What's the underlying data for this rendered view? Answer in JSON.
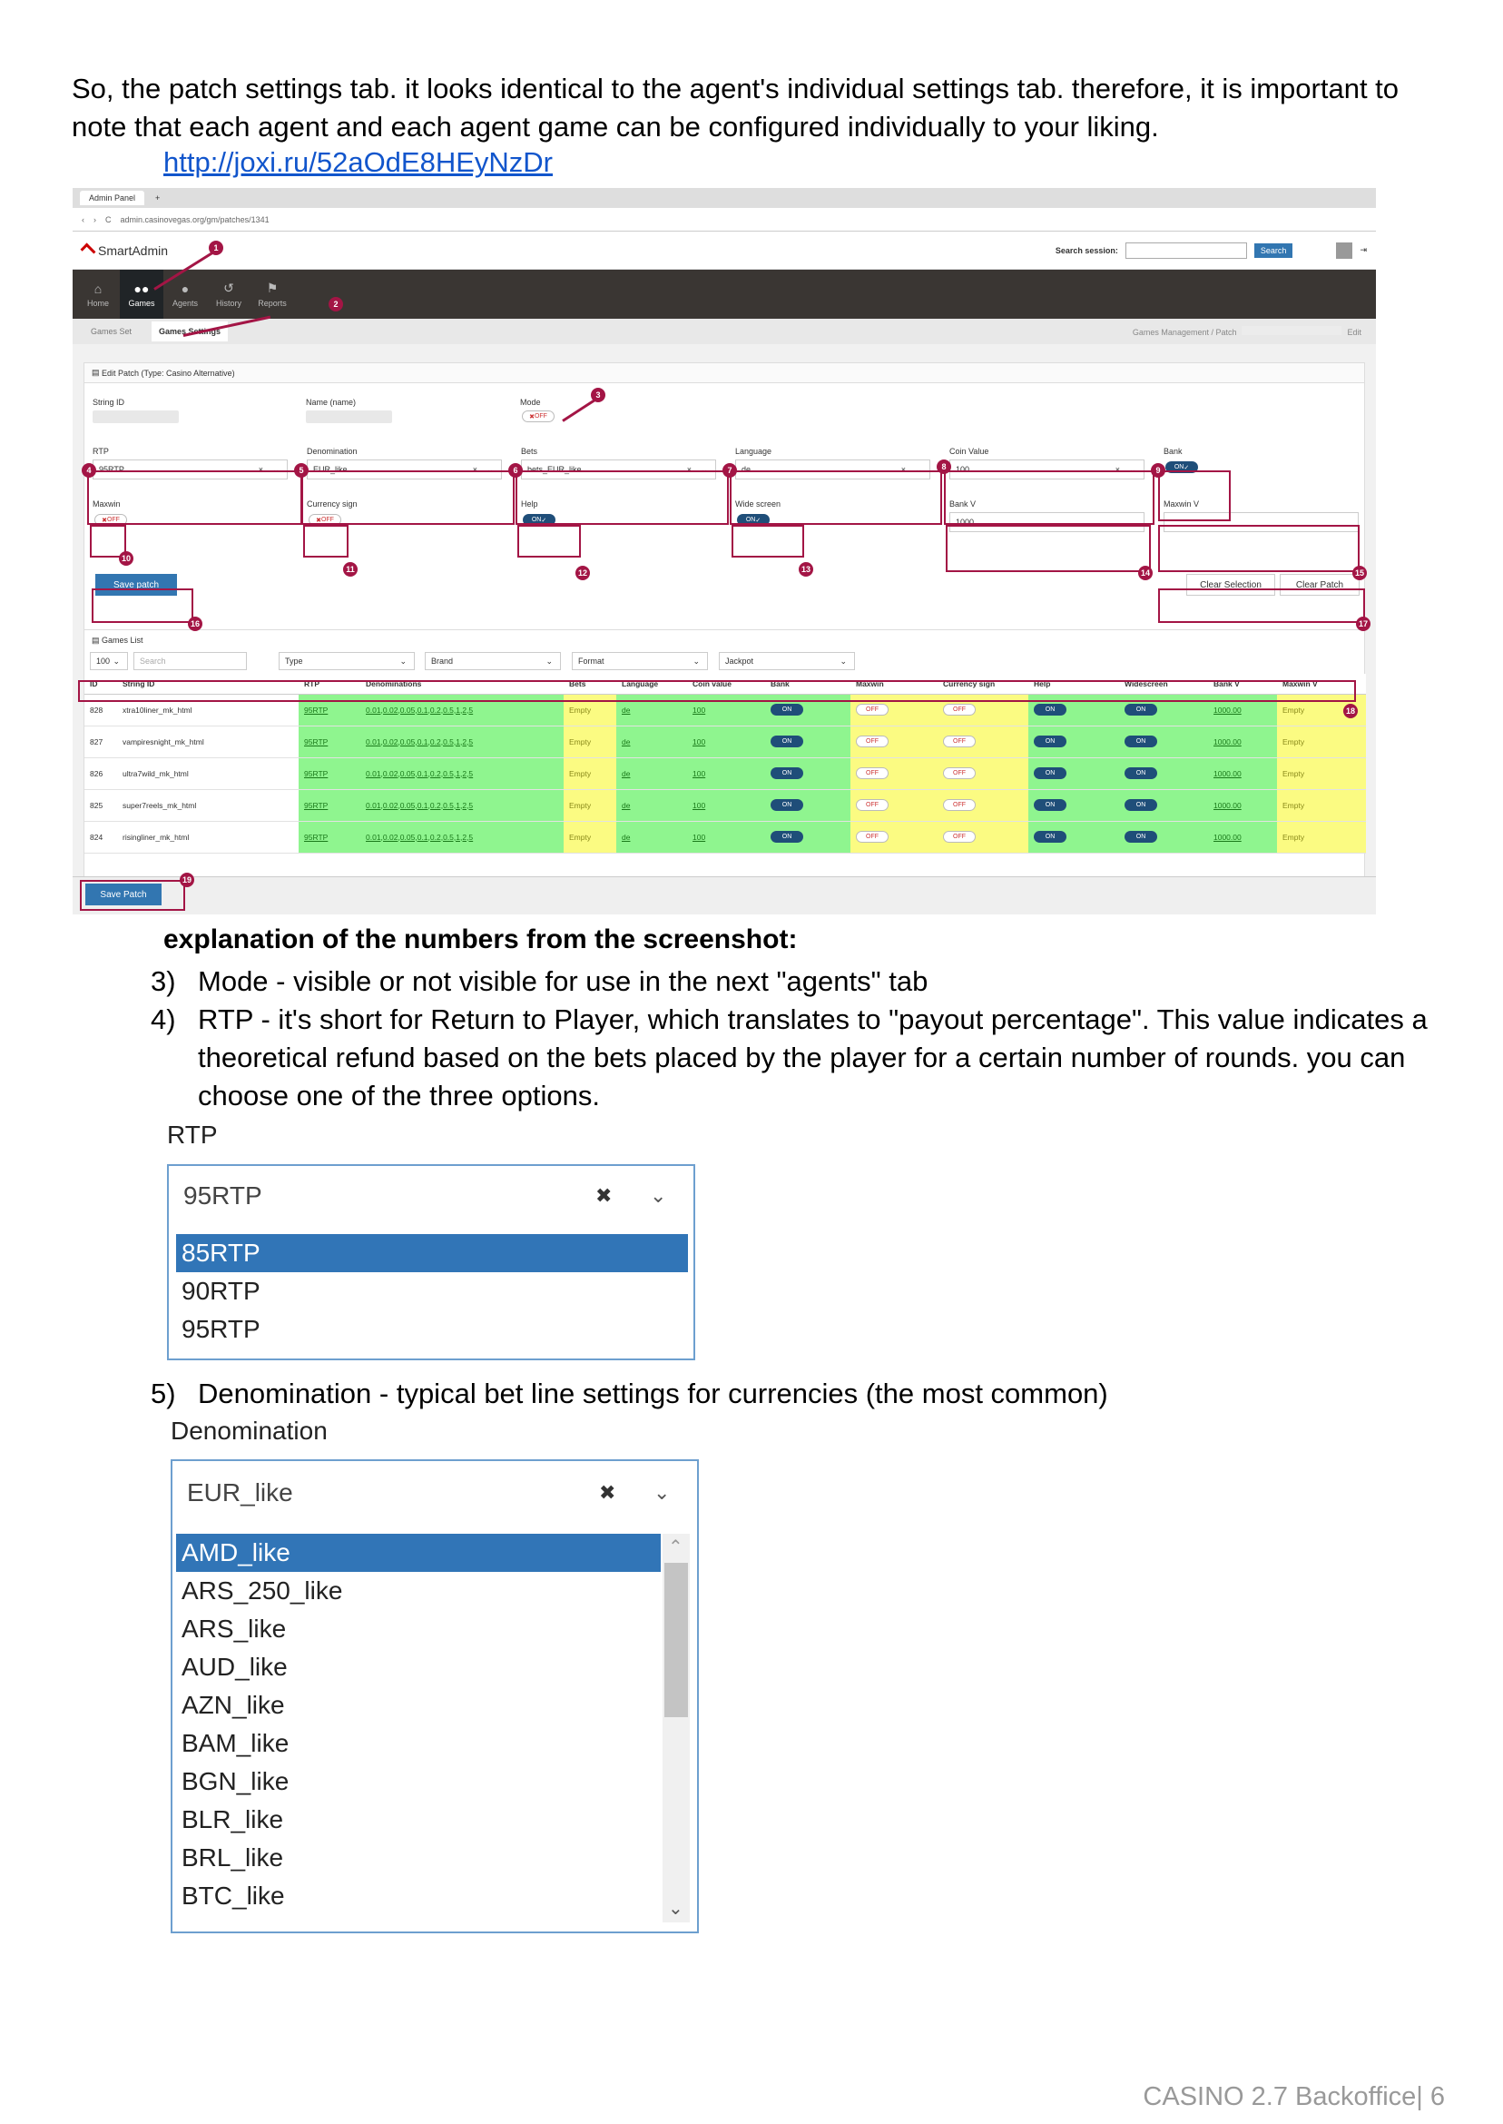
{
  "intro": "So, the patch settings tab. it looks identical to the agent's individual settings tab. therefore, it is important to note that each agent and each agent game can be configured individually to your liking.",
  "link": "http://joxi.ru/52aOdE8HEyNzDr",
  "screenshot": {
    "browser_tab": "Admin Panel",
    "url": "admin.casinovegas.org/gm/patches/1341",
    "logo": "SmartAdmin",
    "search_label": "Search session:",
    "search_button": "Search",
    "nav": [
      "Home",
      "Games",
      "Agents",
      "History",
      "Reports"
    ],
    "subnav": [
      "Games Set",
      "Games Settings"
    ],
    "breadcrumb": "Games Management  /  Patch",
    "breadcrumb_edit": "Edit",
    "edit_title": "Edit Patch (Type: Casino Alternative)",
    "string_id_label": "String ID",
    "name_label": "Name (name)",
    "mode_label": "Mode",
    "fields": {
      "rtp": {
        "label": "RTP",
        "value": "95RTP"
      },
      "denomination": {
        "label": "Denomination",
        "value": "EUR_like"
      },
      "bets": {
        "label": "Bets",
        "value": "bets_EUR_like"
      },
      "language": {
        "label": "Language",
        "value": "de"
      },
      "coin_value": {
        "label": "Coin Value",
        "value": "100"
      },
      "bank": {
        "label": "Bank"
      },
      "maxwin": {
        "label": "Maxwin"
      },
      "currency_sign": {
        "label": "Currency sign"
      },
      "help": {
        "label": "Help"
      },
      "wide_screen": {
        "label": "Wide screen"
      },
      "bank_v": {
        "label": "Bank V",
        "value": "1000"
      },
      "maxwin_v": {
        "label": "Maxwin V"
      }
    },
    "toggle_on": "ON",
    "toggle_off": "OFF",
    "save_patch": "Save patch",
    "clear_selection": "Clear Selection",
    "clear_patch": "Clear Patch",
    "games_list_title": "Games List",
    "filters": {
      "per_page": "100",
      "search": "Search",
      "type": "Type",
      "brand": "Brand",
      "format": "Format",
      "jackpot": "Jackpot"
    },
    "columns": [
      "ID",
      "String ID",
      "RTP",
      "Denominations",
      "Bets",
      "Language",
      "Coin value",
      "Bank",
      "Maxwin",
      "Currency sign",
      "Help",
      "Widescreen",
      "Bank V",
      "Maxwin V"
    ],
    "rows": [
      {
        "id": "828",
        "sid": "xtra10liner_mk_html",
        "rtp": "95RTP",
        "den": "0.01,0.02,0.05,0.1,0.2,0.5,1,2,5",
        "bets": "Empty",
        "lang": "de",
        "coin": "100",
        "bankv": "1000.00",
        "maxv": "Empty"
      },
      {
        "id": "827",
        "sid": "vampiresnight_mk_html",
        "rtp": "95RTP",
        "den": "0.01,0.02,0.05,0.1,0.2,0.5,1,2,5",
        "bets": "Empty",
        "lang": "de",
        "coin": "100",
        "bankv": "1000.00",
        "maxv": "Empty"
      },
      {
        "id": "826",
        "sid": "ultra7wild_mk_html",
        "rtp": "95RTP",
        "den": "0.01,0.02,0.05,0.1,0.2,0.5,1,2,5",
        "bets": "Empty",
        "lang": "de",
        "coin": "100",
        "bankv": "1000.00",
        "maxv": "Empty"
      },
      {
        "id": "825",
        "sid": "super7reels_mk_html",
        "rtp": "95RTP",
        "den": "0.01,0.02,0.05,0.1,0.2,0.5,1,2,5",
        "bets": "Empty",
        "lang": "de",
        "coin": "100",
        "bankv": "1000.00",
        "maxv": "Empty"
      },
      {
        "id": "824",
        "sid": "risingliner_mk_html",
        "rtp": "95RTP",
        "den": "0.01,0.02,0.05,0.1,0.2,0.5,1,2,5",
        "bets": "Empty",
        "lang": "de",
        "coin": "100",
        "bankv": "1000.00",
        "maxv": "Empty"
      }
    ],
    "save_patch_bottom": "Save Patch",
    "badges": [
      "1",
      "2",
      "3",
      "4",
      "5",
      "6",
      "7",
      "8",
      "9",
      "10",
      "11",
      "12",
      "13",
      "14",
      "15",
      "16",
      "17",
      "18",
      "19"
    ]
  },
  "explanation_heading": "explanation of the numbers from the screenshot:",
  "items": [
    {
      "num": "3)",
      "text": "Mode - visible or not visible for use in the next \"agents\" tab"
    },
    {
      "num": "4)",
      "text": "RTP -  it's short for Return to Player, which translates to \"payout percentage\". This value indicates a theoretical refund based on the bets placed by the player for a certain number of rounds. you can choose one of the three options."
    },
    {
      "num": "5)",
      "text": "Denomination - typical bet line settings for currencies (the most common)"
    }
  ],
  "rtp_dropdown": {
    "label": "RTP",
    "selected": "95RTP",
    "options": [
      "85RTP",
      "90RTP",
      "95RTP"
    ]
  },
  "denom_dropdown": {
    "label": "Denomination",
    "selected": "EUR_like",
    "options": [
      "AMD_like",
      "ARS_250_like",
      "ARS_like",
      "AUD_like",
      "AZN_like",
      "BAM_like",
      "BGN_like",
      "BLR_like",
      "BRL_like",
      "BTC_like"
    ]
  },
  "footer": "CASINO 2.7 Backoffice| 6"
}
